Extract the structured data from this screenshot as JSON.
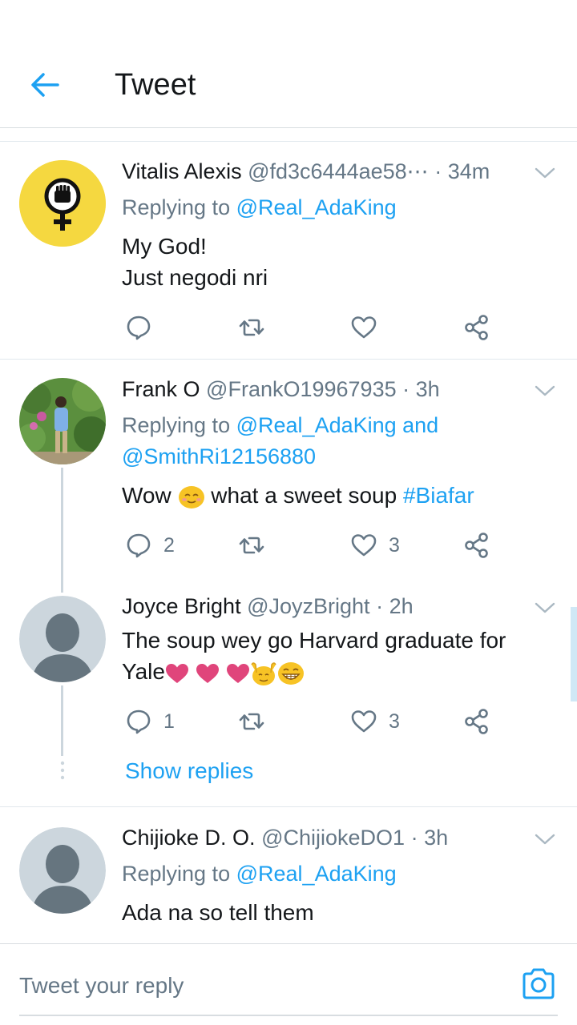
{
  "header": {
    "title": "Tweet"
  },
  "tweets": [
    {
      "name": "Vitalis Alexis",
      "handle": "@fd3c6444ae58⋯",
      "time": "34m",
      "replying_prefix": "Replying to",
      "replying_to": "@Real_AdaKing",
      "text_lines": [
        "My God!",
        "Just negodi nri"
      ],
      "counts": {
        "reply": "",
        "retweet": "",
        "like": ""
      }
    },
    {
      "name": "Frank O",
      "handle": "@FrankO19967935",
      "time": "3h",
      "replying_prefix": "Replying to",
      "replying_to": "@Real_AdaKing and",
      "replying_to_2": "@SmithRi12156880",
      "text_a": "Wow",
      "text_b": "what a sweet soup",
      "hashtag": "#Biafar",
      "counts": {
        "reply": "2",
        "retweet": "",
        "like": "3"
      }
    },
    {
      "name": "Joyce Bright",
      "handle": "@JoyzBright",
      "time": "2h",
      "text_line1": "The soup wey go Harvard graduate for",
      "text_line2": "Yale",
      "counts": {
        "reply": "1",
        "retweet": "",
        "like": "3"
      }
    },
    {
      "name": "Chijioke D. O.",
      "handle": "@ChijiokeDO1",
      "time": "3h",
      "replying_prefix": "Replying to",
      "replying_to": "@Real_AdaKing",
      "text_lines": [
        "Ada na so tell them"
      ]
    }
  ],
  "show_replies": "Show replies",
  "reply_bar": {
    "placeholder": "Tweet your reply"
  },
  "colors": {
    "accent": "#1da1f2",
    "text": "#14171a",
    "muted": "#657786",
    "avatar_yellow": "#f5d840",
    "default_avatar_bg": "#ccd6dd"
  },
  "icons": [
    "back-arrow-icon",
    "chevron-down-icon",
    "reply-icon",
    "retweet-icon",
    "like-icon",
    "share-icon",
    "camera-icon",
    "venus-fist-icon",
    "default-avatar-icon"
  ]
}
